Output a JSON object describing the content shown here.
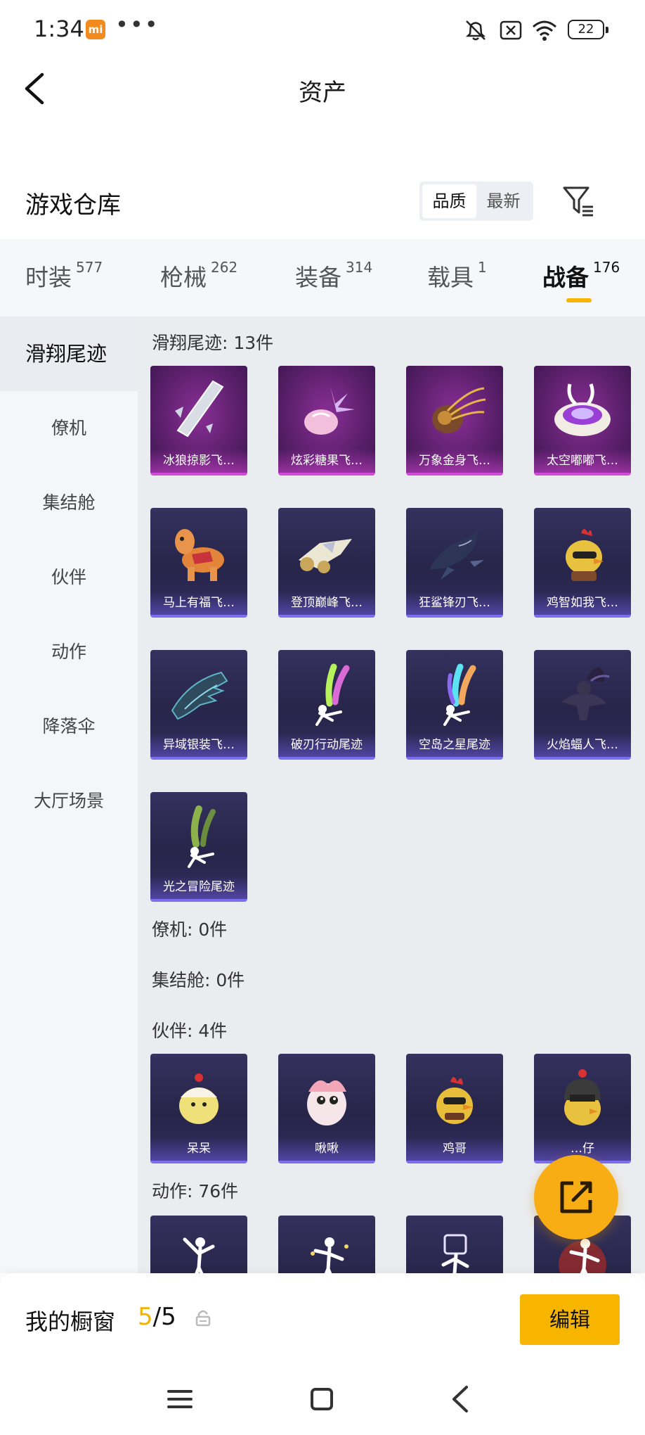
{
  "status": {
    "time": "1:34",
    "app_badge": "mi",
    "more": "•••",
    "battery": "22"
  },
  "header": {
    "title": "资产"
  },
  "warehouse": {
    "title": "游戏仓库",
    "sort": [
      "品质",
      "最新"
    ]
  },
  "tabs": [
    {
      "label": "时装",
      "count": "577"
    },
    {
      "label": "枪械",
      "count": "262"
    },
    {
      "label": "装备",
      "count": "314"
    },
    {
      "label": "载具",
      "count": "1"
    },
    {
      "label": "战备",
      "count": "176"
    }
  ],
  "sidebar": [
    "滑翔尾迹",
    "僚机",
    "集结舱",
    "伙伴",
    "动作",
    "降落伞",
    "大厅场景"
  ],
  "sections": {
    "glide": {
      "title": "滑翔尾迹: 13件",
      "items": [
        "冰狼掠影飞…",
        "炫彩糖果飞…",
        "万象金身飞…",
        "太空嘟嘟飞…",
        "马上有福飞…",
        "登顶巅峰飞…",
        "狂鲨锋刃飞…",
        "鸡智如我飞…",
        "异域银装飞…",
        "破刃行动尾迹",
        "空岛之星尾迹",
        "火焰蝠人飞…",
        "光之冒险尾迹"
      ]
    },
    "wingman": {
      "title": "僚机: 0件"
    },
    "pod": {
      "title": "集结舱: 0件"
    },
    "partner": {
      "title": "伙伴: 4件",
      "items": [
        "呆呆",
        "啾啾",
        "鸡哥",
        "…仔"
      ]
    },
    "emote": {
      "title": "动作: 76件"
    }
  },
  "showcase": {
    "label": "我的橱窗",
    "current": "5",
    "total": "/5",
    "edit": "编辑"
  },
  "colors": {
    "accent": "#f7b500",
    "card_bg": "#2a2850",
    "card_rare": "#5a1f6a"
  }
}
